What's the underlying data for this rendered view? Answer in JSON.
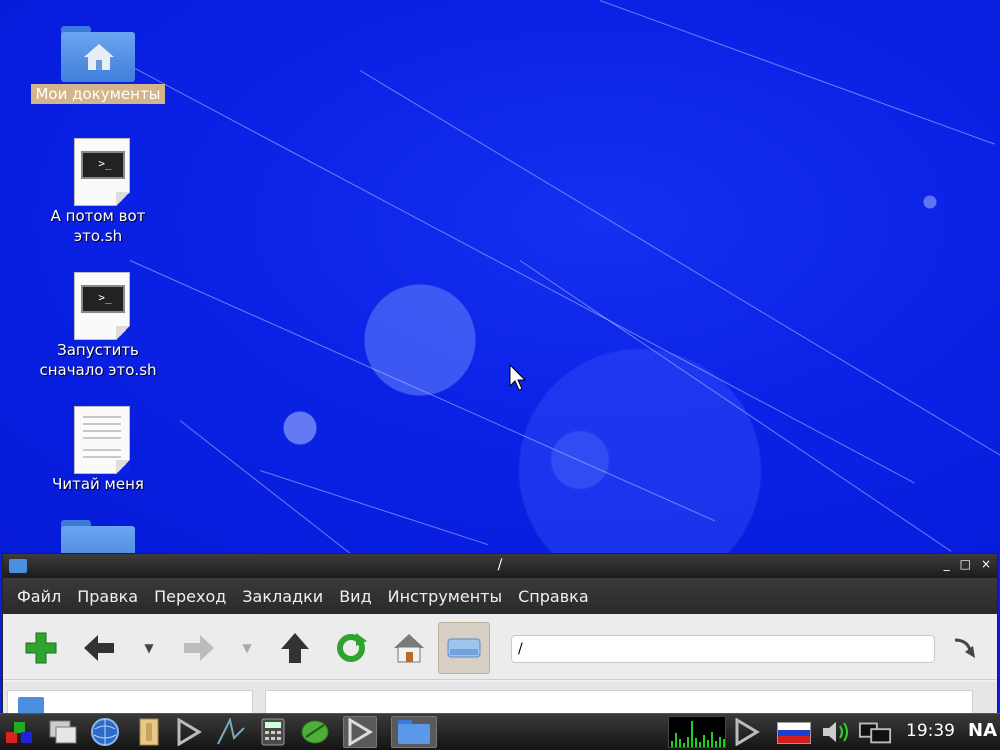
{
  "desktop": {
    "icons": [
      {
        "label_lines": [
          "Мои документы"
        ],
        "icon": "home-folder-icon"
      },
      {
        "label_lines": [
          "А потом вот",
          "это.sh"
        ],
        "icon": "shell-script-icon"
      },
      {
        "label_lines": [
          "Запустить",
          "сначало это.sh"
        ],
        "icon": "shell-script-icon"
      },
      {
        "label_lines": [
          "Читай меня"
        ],
        "icon": "text-document-icon"
      },
      {
        "label_lines": [
          ""
        ],
        "icon": "folder-icon"
      }
    ],
    "term_prompt": ">_"
  },
  "window": {
    "title": "/",
    "controls": [
      "_",
      "□",
      "×"
    ],
    "menu": [
      "Файл",
      "Правка",
      "Переход",
      "Закладки",
      "Вид",
      "Инструменты",
      "Справка"
    ],
    "address": "/",
    "toolbar": [
      "new-tab-icon",
      "back-icon",
      "back-history-dropdown-icon",
      "forward-icon",
      "forward-history-dropdown-icon",
      "up-icon",
      "reload-icon",
      "home-icon",
      "computer-icon",
      "go-icon"
    ]
  },
  "taskbar": {
    "apps": [
      "menu-icon",
      "show-desktop-icon",
      "browser-icon",
      "file-cabinet-icon",
      "terminal-icon",
      "chart-icon",
      "calculator-icon",
      "notes-icon",
      "terminal-active-icon",
      "file-manager-icon"
    ],
    "tray": [
      "cpu-monitor-icon",
      "terminal-tray-icon",
      "keyboard-layout-flag-icon",
      "volume-icon",
      "network-icon"
    ],
    "clock": "19:39",
    "label": "NA"
  },
  "colors": {
    "desktop_bg": "#0b22e6",
    "selection_label": "#d2b58a",
    "menubar": "#2f2f2f",
    "toolbar": "#ececec"
  }
}
